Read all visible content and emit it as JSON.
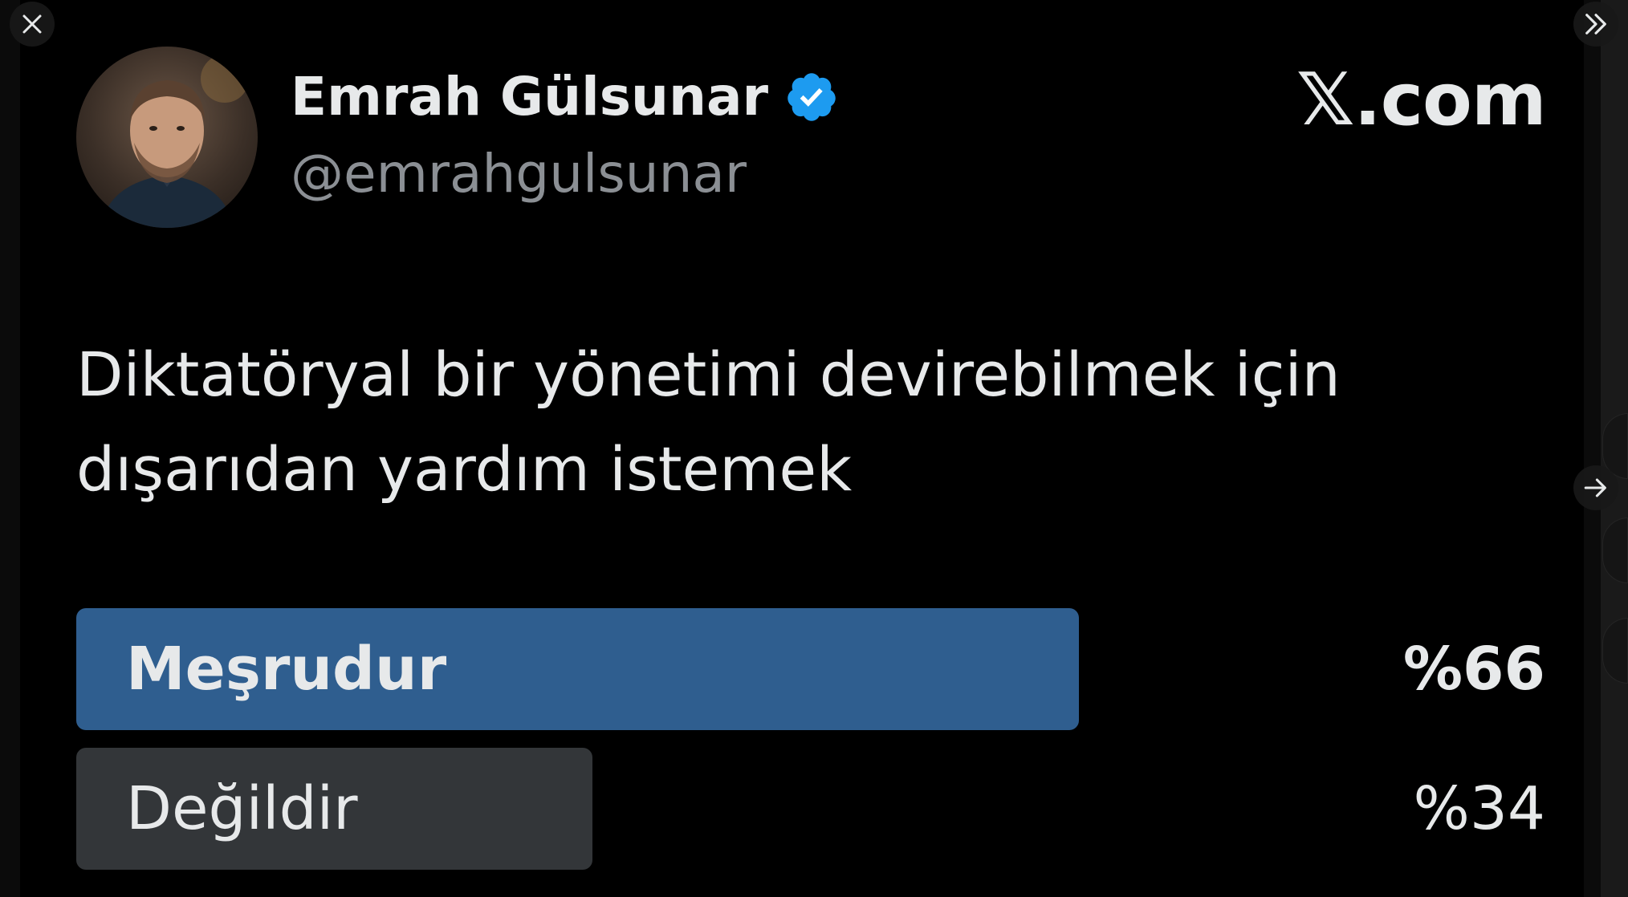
{
  "viewer": {
    "close_label": "Close",
    "collapse_label": "Collapse",
    "next_label": "Next"
  },
  "tweet": {
    "author_name": "Emrah Gülsunar",
    "handle": "@emrahgulsunar",
    "verified": true,
    "brand": "𝕏.com",
    "question": "Diktatöryal bir yönetimi devirebilmek için dışarıdan yardım istemek"
  },
  "poll": {
    "options": [
      {
        "label": "Meşrudur",
        "percent_text": "%66",
        "share": 0.66,
        "leading": true
      },
      {
        "label": "Değildir",
        "percent_text": "%34",
        "share": 0.34,
        "leading": false
      }
    ]
  },
  "colors": {
    "leading_bar": "#2f5e8f",
    "other_bar": "#333639",
    "verified_badge": "#1d9bf0",
    "background": "#000000"
  },
  "icons": {
    "close": "close-icon",
    "collapse": "chevron-double-right-icon",
    "next": "arrow-right-icon",
    "verified": "verified-badge-icon"
  }
}
